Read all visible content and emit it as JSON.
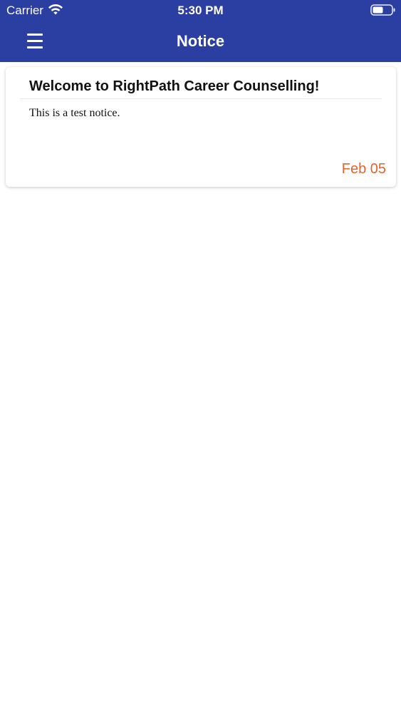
{
  "status_bar": {
    "carrier": "Carrier",
    "time": "5:30 PM",
    "wifi_icon": "wifi-icon",
    "battery_icon": "battery-icon"
  },
  "nav": {
    "title": "Notice",
    "menu_icon": "hamburger-menu-icon"
  },
  "notices": [
    {
      "title": "Welcome to RightPath Career Counselling!",
      "body": "This is a test notice.",
      "date": "Feb 05"
    }
  ],
  "colors": {
    "header": "#2b3ea1",
    "date": "#e6622a",
    "background": "#ffffff"
  }
}
